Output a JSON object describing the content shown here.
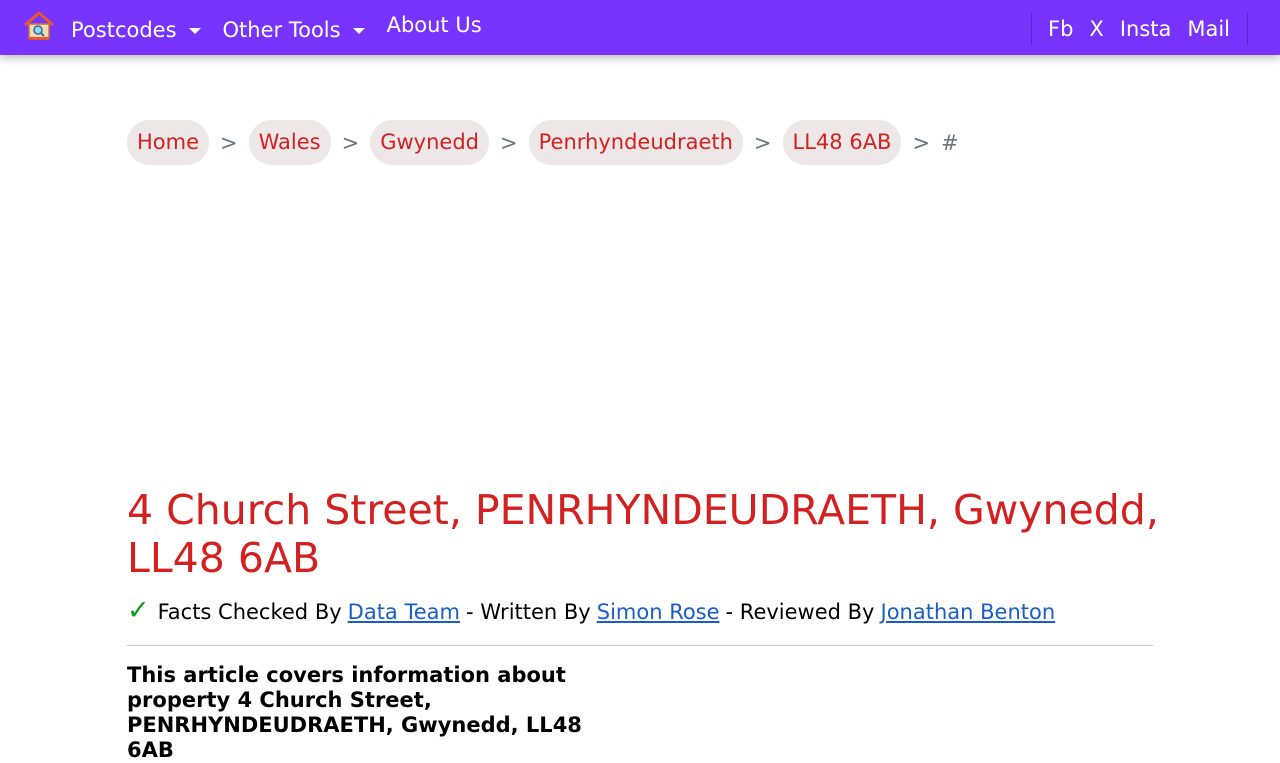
{
  "nav": {
    "postcodes": "Postcodes",
    "other_tools": "Other Tools",
    "about": "About Us",
    "social": [
      "Fb",
      "X",
      "Insta",
      "Mail"
    ]
  },
  "breadcrumb": {
    "items": [
      "Home",
      "Wales",
      "Gwynedd",
      "Penrhyndeudraeth",
      "LL48 6AB"
    ],
    "separator": ">",
    "current": "#"
  },
  "article": {
    "title": "4 Church Street, PENRHYNDEUDRAETH, Gwynedd, LL48 6AB",
    "facts_label": "Facts Checked By",
    "facts_by": "Data Team",
    "written_label": "- Written By",
    "written_by": "Simon Rose",
    "reviewed_label": "- Reviewed By",
    "reviewed_by": "Jonathan Benton",
    "intro": "This article covers information about property 4 Church Street, PENRHYNDEUDRAETH, Gwynedd, LL48 6AB"
  },
  "colors": {
    "navbar": "#7634fe",
    "accent": "#d32020",
    "link": "#1a5ec4",
    "check": "#0a9a1a"
  }
}
